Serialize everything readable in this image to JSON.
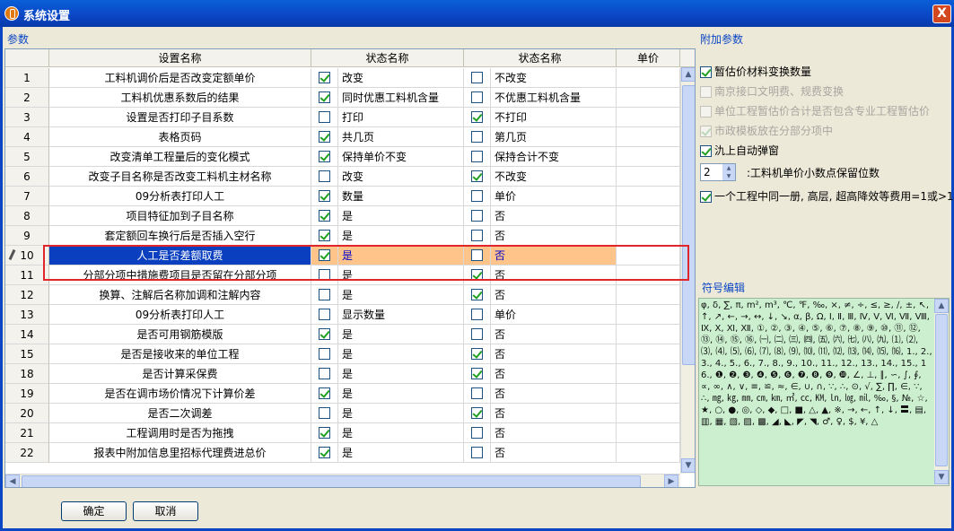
{
  "window": {
    "title": "系统设置",
    "close_label": "X"
  },
  "left_group_title": "参数",
  "right_group_title": "附加参数",
  "grid": {
    "headers": [
      "",
      "设置名称",
      "状态名称",
      "状态名称",
      "单价"
    ],
    "rows": [
      {
        "num": "1",
        "name": "工料机调价后是否改变定额单价",
        "s1_checked": true,
        "s1": "改变",
        "s2_checked": false,
        "s2": "不改变"
      },
      {
        "num": "2",
        "name": "工料机优惠系数后的结果",
        "s1_checked": true,
        "s1": "同时优惠工料机含量",
        "s2_checked": false,
        "s2": "不优惠工料机含量"
      },
      {
        "num": "3",
        "name": "设置是否打印子目系数",
        "s1_checked": false,
        "s1": "打印",
        "s2_checked": true,
        "s2": "不打印"
      },
      {
        "num": "4",
        "name": "表格页码",
        "s1_checked": true,
        "s1": "共几页",
        "s2_checked": false,
        "s2": "第几页"
      },
      {
        "num": "5",
        "name": "改变清单工程量后的变化模式",
        "s1_checked": true,
        "s1": "保持单价不变",
        "s2_checked": false,
        "s2": "保持合计不变"
      },
      {
        "num": "6",
        "name": "改变子目名称是否改变工料机主材名称",
        "s1_checked": false,
        "s1": "改变",
        "s2_checked": true,
        "s2": "不改变"
      },
      {
        "num": "7",
        "name": "09分析表打印人工",
        "s1_checked": true,
        "s1": "数量",
        "s2_checked": false,
        "s2": "单价"
      },
      {
        "num": "8",
        "name": "项目特征加到子目名称",
        "s1_checked": true,
        "s1": "是",
        "s2_checked": false,
        "s2": "否"
      },
      {
        "num": "9",
        "name": "套定额回车换行后是否插入空行",
        "s1_checked": true,
        "s1": "是",
        "s2_checked": false,
        "s2": "否"
      },
      {
        "num": "10",
        "name": "人工是否差额取费",
        "s1_checked": true,
        "s1": "是",
        "s2_checked": false,
        "s2": "否",
        "selected": true
      },
      {
        "num": "11",
        "name": "分部分项中措施费项目是否留在分部分项",
        "s1_checked": false,
        "s1": "是",
        "s2_checked": true,
        "s2": "否"
      },
      {
        "num": "12",
        "name": "换算、注解后名称加调和注解内容",
        "s1_checked": false,
        "s1": "是",
        "s2_checked": true,
        "s2": "否"
      },
      {
        "num": "13",
        "name": "09分析表打印人工",
        "s1_checked": false,
        "s1": "显示数量",
        "s2_checked": false,
        "s2": "单价"
      },
      {
        "num": "14",
        "name": "是否可用钢筋模版",
        "s1_checked": true,
        "s1": "是",
        "s2_checked": false,
        "s2": "否"
      },
      {
        "num": "15",
        "name": "是否是接收来的单位工程",
        "s1_checked": false,
        "s1": "是",
        "s2_checked": true,
        "s2": "否"
      },
      {
        "num": "18",
        "name": "是否计算采保费",
        "s1_checked": false,
        "s1": "是",
        "s2_checked": true,
        "s2": "否"
      },
      {
        "num": "19",
        "name": "是否在调市场价情况下计算价差",
        "s1_checked": true,
        "s1": "是",
        "s2_checked": false,
        "s2": "否"
      },
      {
        "num": "20",
        "name": "是否二次调差",
        "s1_checked": false,
        "s1": "是",
        "s2_checked": true,
        "s2": "否"
      },
      {
        "num": "21",
        "name": "工程调用时是否为拖拽",
        "s1_checked": true,
        "s1": "是",
        "s2_checked": false,
        "s2": "否"
      },
      {
        "num": "22",
        "name": "报表中附加信息里招标代理费进总价",
        "s1_checked": true,
        "s1": "是",
        "s2_checked": false,
        "s2": "否"
      }
    ]
  },
  "options": [
    {
      "label": "暂估价材料变换数量",
      "checked": true,
      "disabled": false
    },
    {
      "label": "南京接口文明费、规费变换",
      "checked": false,
      "disabled": true
    },
    {
      "label": "单位工程暂估价合计是否包含专业工程暂估价",
      "checked": false,
      "disabled": true
    },
    {
      "label": "市政模板放在分部分项中",
      "checked": true,
      "disabled": true
    },
    {
      "label": "氿上自动弹窗",
      "checked": true,
      "disabled": false
    }
  ],
  "decimal": {
    "value": "2",
    "label": ":工料机单价小数点保留位数"
  },
  "one_book": {
    "label": "一个工程中同一册, 高层, 超高降效等费用=1或>1",
    "checked": true
  },
  "symbols": {
    "title": "符号编辑",
    "text": "φ, δ, ∑, π, m², m³, ℃, ℉, ‰, ×, ≠, ÷, ≤, ≥, ∕, ±, ↖, ↑, ↗, ←, →, ↔, ↓, ↘, α, β, Ω, Ⅰ, Ⅱ, Ⅲ, Ⅳ, Ⅴ, Ⅵ, Ⅶ, Ⅷ, Ⅸ, Ⅹ, Ⅺ, Ⅻ, ①, ②, ③, ④, ⑤, ⑥, ⑦, ⑧, ⑨, ⑩, ⑪, ⑫, ⑬, ⑭, ⑮, ⑯, ㈠, ㈡, ㈢, ㈣, ㈤, ㈥, ㈦, ㈧, ㈨, ⑴, ⑵, ⑶, ⑷, ⑸, ⑹, ⑺, ⑻, ⑼, ⑽, ⑾, ⑿, ⒀, ⒁, ⒂, ⒃, 1., 2., 3., 4., 5., 6., 7., 8., 9., 10., 11., 12., 13., 14., 15., 16., ❶, ❷, ❸, ❹, ❺, ❻, ❼, ❽, ❾, ❿, ∠, ⊥, ∥, ∽, ∫, ∮, ∝, ∞, ∧, ∨, ≡, ≌, ≈, ∈, ∪, ∩, ∵, ∴, ⊙, √, ∑, ∏, ∈, ∵, ∴, ㎎, ㎏, ㎜, ㎝, ㎞, ㎡, ㏄, ㏎, ㏑, ㏒, ㏕, ‰, §, №, ☆, ★, ○, ●, ◎, ◇, ◆, □, ■, △, ▲, ※, →, ←, ↑, ↓, 〓, ▤, ▥, ▦, ▧, ▨, ▩, ◢, ◣, ◤, ◥, ♂, ♀, $, ¥, △"
  },
  "buttons": {
    "ok": "确定",
    "cancel": "取消"
  }
}
